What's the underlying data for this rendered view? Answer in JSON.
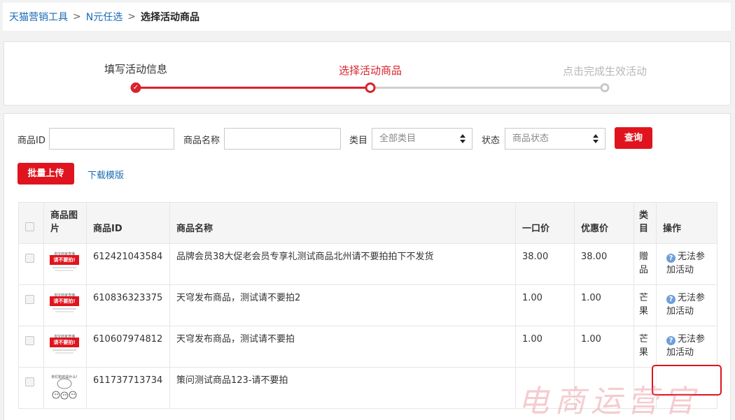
{
  "breadcrumb": {
    "items": [
      "天猫营销工具",
      "N元任选"
    ],
    "current": "选择活动商品",
    "separator": ">"
  },
  "steps": [
    {
      "label": "填写活动信息",
      "state": "done"
    },
    {
      "label": "选择活动商品",
      "state": "active"
    },
    {
      "label": "点击完成生效活动",
      "state": "todo"
    }
  ],
  "filters": {
    "product_id_label": "商品ID",
    "product_id_value": "",
    "product_name_label": "商品名称",
    "product_name_value": "",
    "category_label": "类目",
    "category_selected": "全部类目",
    "status_label": "状态",
    "status_selected": "商品状态",
    "query_button": "查询"
  },
  "actions": {
    "batch_upload": "批量上传",
    "download_template": "下载模版"
  },
  "table": {
    "headers": {
      "image": "商品图片",
      "id": "商品ID",
      "name": "商品名称",
      "price": "一口价",
      "promo_price": "优惠价",
      "category": "类目",
      "operation": "操作"
    },
    "rows": [
      {
        "thumb": "promo",
        "id": "612421043584",
        "name": "品牌会员38大促老会员专享礼测试商品北州请不要拍拍下不发货",
        "price": "38.00",
        "promo_price": "38.00",
        "promo_highlight": false,
        "category": "赠品",
        "operation": "无法参加活动"
      },
      {
        "thumb": "promo",
        "id": "610836323375",
        "name": "天穹发布商品，测试请不要拍2",
        "price": "1.00",
        "promo_price": "1.00",
        "promo_highlight": true,
        "category": "芒果",
        "operation": "无法参加活动"
      },
      {
        "thumb": "promo",
        "id": "610607974812",
        "name": "天穹发布商品，测试请不要拍",
        "price": "1.00",
        "promo_price": "1.00",
        "promo_highlight": true,
        "category": "芒果",
        "operation": "无法参加活动"
      },
      {
        "thumb": "doodle",
        "id": "611737713734",
        "name": "策问测试商品123-请不要拍",
        "price": "",
        "promo_price": "",
        "promo_highlight": false,
        "category": "",
        "operation": ""
      }
    ],
    "thumb_promo_caption": "淘宝商家直播",
    "thumb_promo_banner": "请不要拍!",
    "thumb_doodle_caption": "你们拍的是什么!"
  },
  "watermark": "电商运营官",
  "colors": {
    "brand_red": "#e0141e",
    "step_red": "#d8232c",
    "link_blue": "#1a6bb5"
  }
}
